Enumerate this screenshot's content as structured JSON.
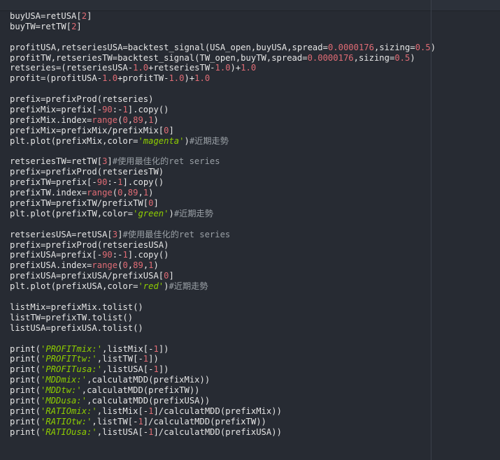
{
  "editor": {
    "lines": [
      [
        {
          "t": "buyUSA=retUSA[",
          "k": "txt"
        },
        {
          "t": "2",
          "k": "num"
        },
        {
          "t": "]",
          "k": "txt"
        }
      ],
      [
        {
          "t": "buyTW=retTW[",
          "k": "txt"
        },
        {
          "t": "2",
          "k": "num"
        },
        {
          "t": "]",
          "k": "txt"
        }
      ],
      [],
      [
        {
          "t": "profitUSA,retseriesUSA=backtest_signal(USA_open,buyUSA,spread=",
          "k": "txt"
        },
        {
          "t": "0.0000176",
          "k": "num"
        },
        {
          "t": ",sizing=",
          "k": "txt"
        },
        {
          "t": "0.5",
          "k": "num"
        },
        {
          "t": ")",
          "k": "txt"
        }
      ],
      [
        {
          "t": "profitTW,retseriesTW=backtest_signal(TW_open,buyTW,spread=",
          "k": "txt"
        },
        {
          "t": "0.0000176",
          "k": "num"
        },
        {
          "t": ",sizing=",
          "k": "txt"
        },
        {
          "t": "0.5",
          "k": "num"
        },
        {
          "t": ")",
          "k": "txt"
        }
      ],
      [
        {
          "t": "retseries=(retseriesUSA-",
          "k": "txt"
        },
        {
          "t": "1.0",
          "k": "num"
        },
        {
          "t": "+retseriesTW-",
          "k": "txt"
        },
        {
          "t": "1.0",
          "k": "num"
        },
        {
          "t": ")+",
          "k": "txt"
        },
        {
          "t": "1.0",
          "k": "num"
        }
      ],
      [
        {
          "t": "profit=(profitUSA-",
          "k": "txt"
        },
        {
          "t": "1.0",
          "k": "num"
        },
        {
          "t": "+profitTW-",
          "k": "txt"
        },
        {
          "t": "1.0",
          "k": "num"
        },
        {
          "t": ")+",
          "k": "txt"
        },
        {
          "t": "1.0",
          "k": "num"
        }
      ],
      [],
      [
        {
          "t": "prefix=prefixProd(retseries)",
          "k": "txt"
        }
      ],
      [
        {
          "t": "prefixMix=prefix[-",
          "k": "txt"
        },
        {
          "t": "90",
          "k": "num"
        },
        {
          "t": ":-",
          "k": "txt"
        },
        {
          "t": "1",
          "k": "num"
        },
        {
          "t": "].copy()",
          "k": "txt"
        }
      ],
      [
        {
          "t": "prefixMix.index=",
          "k": "txt"
        },
        {
          "t": "range",
          "k": "fn"
        },
        {
          "t": "(",
          "k": "txt"
        },
        {
          "t": "0",
          "k": "num"
        },
        {
          "t": ",",
          "k": "txt"
        },
        {
          "t": "89",
          "k": "num"
        },
        {
          "t": ",",
          "k": "txt"
        },
        {
          "t": "1",
          "k": "num"
        },
        {
          "t": ")",
          "k": "txt"
        }
      ],
      [
        {
          "t": "prefixMix=prefixMix/prefixMix[",
          "k": "txt"
        },
        {
          "t": "0",
          "k": "num"
        },
        {
          "t": "]",
          "k": "txt"
        }
      ],
      [
        {
          "t": "plt.plot(prefixMix,color=",
          "k": "txt"
        },
        {
          "t": "'magenta'",
          "k": "str"
        },
        {
          "t": ")",
          "k": "txt"
        },
        {
          "t": "#近期走勢",
          "k": "cmt"
        }
      ],
      [],
      [
        {
          "t": "retseriesTW=retTW[",
          "k": "txt"
        },
        {
          "t": "3",
          "k": "num"
        },
        {
          "t": "]",
          "k": "txt"
        },
        {
          "t": "#使用最佳化的ret series",
          "k": "cmt"
        }
      ],
      [
        {
          "t": "prefix=prefixProd(retseriesTW)",
          "k": "txt"
        }
      ],
      [
        {
          "t": "prefixTW=prefix[-",
          "k": "txt"
        },
        {
          "t": "90",
          "k": "num"
        },
        {
          "t": ":-",
          "k": "txt"
        },
        {
          "t": "1",
          "k": "num"
        },
        {
          "t": "].copy()",
          "k": "txt"
        }
      ],
      [
        {
          "t": "prefixTW.index=",
          "k": "txt"
        },
        {
          "t": "range",
          "k": "fn"
        },
        {
          "t": "(",
          "k": "txt"
        },
        {
          "t": "0",
          "k": "num"
        },
        {
          "t": ",",
          "k": "txt"
        },
        {
          "t": "89",
          "k": "num"
        },
        {
          "t": ",",
          "k": "txt"
        },
        {
          "t": "1",
          "k": "num"
        },
        {
          "t": ")",
          "k": "txt"
        }
      ],
      [
        {
          "t": "prefixTW=prefixTW/prefixTW[",
          "k": "txt"
        },
        {
          "t": "0",
          "k": "num"
        },
        {
          "t": "]",
          "k": "txt"
        }
      ],
      [
        {
          "t": "plt.plot(prefixTW,color=",
          "k": "txt"
        },
        {
          "t": "'green'",
          "k": "str"
        },
        {
          "t": ")",
          "k": "txt"
        },
        {
          "t": "#近期走勢",
          "k": "cmt"
        }
      ],
      [],
      [
        {
          "t": "retseriesUSA=retUSA[",
          "k": "txt"
        },
        {
          "t": "3",
          "k": "num"
        },
        {
          "t": "]",
          "k": "txt"
        },
        {
          "t": "#使用最佳化的ret series",
          "k": "cmt"
        }
      ],
      [
        {
          "t": "prefix=prefixProd(retseriesUSA)",
          "k": "txt"
        }
      ],
      [
        {
          "t": "prefixUSA=prefix[-",
          "k": "txt"
        },
        {
          "t": "90",
          "k": "num"
        },
        {
          "t": ":-",
          "k": "txt"
        },
        {
          "t": "1",
          "k": "num"
        },
        {
          "t": "].copy()",
          "k": "txt"
        }
      ],
      [
        {
          "t": "prefixUSA.index=",
          "k": "txt"
        },
        {
          "t": "range",
          "k": "fn"
        },
        {
          "t": "(",
          "k": "txt"
        },
        {
          "t": "0",
          "k": "num"
        },
        {
          "t": ",",
          "k": "txt"
        },
        {
          "t": "89",
          "k": "num"
        },
        {
          "t": ",",
          "k": "txt"
        },
        {
          "t": "1",
          "k": "num"
        },
        {
          "t": ")",
          "k": "txt"
        }
      ],
      [
        {
          "t": "prefixUSA=prefixUSA/prefixUSA[",
          "k": "txt"
        },
        {
          "t": "0",
          "k": "num"
        },
        {
          "t": "]",
          "k": "txt"
        }
      ],
      [
        {
          "t": "plt.plot(prefixUSA,color=",
          "k": "txt"
        },
        {
          "t": "'red'",
          "k": "str"
        },
        {
          "t": ")",
          "k": "txt"
        },
        {
          "t": "#近期走勢",
          "k": "cmt"
        }
      ],
      [],
      [
        {
          "t": "listMix=prefixMix.tolist()",
          "k": "txt"
        }
      ],
      [
        {
          "t": "listTW=prefixTW.tolist()",
          "k": "txt"
        }
      ],
      [
        {
          "t": "listUSA=prefixUSA.tolist()",
          "k": "txt"
        }
      ],
      [],
      [
        {
          "t": "print(",
          "k": "txt"
        },
        {
          "t": "'PROFITmix:'",
          "k": "str"
        },
        {
          "t": ",listMix[-",
          "k": "txt"
        },
        {
          "t": "1",
          "k": "num"
        },
        {
          "t": "])",
          "k": "txt"
        }
      ],
      [
        {
          "t": "print(",
          "k": "txt"
        },
        {
          "t": "'PROFITtw:'",
          "k": "str"
        },
        {
          "t": ",listTW[-",
          "k": "txt"
        },
        {
          "t": "1",
          "k": "num"
        },
        {
          "t": "])",
          "k": "txt"
        }
      ],
      [
        {
          "t": "print(",
          "k": "txt"
        },
        {
          "t": "'PROFITusa:'",
          "k": "str"
        },
        {
          "t": ",listUSA[-",
          "k": "txt"
        },
        {
          "t": "1",
          "k": "num"
        },
        {
          "t": "])",
          "k": "txt"
        }
      ],
      [
        {
          "t": "print(",
          "k": "txt"
        },
        {
          "t": "'MDDmix:'",
          "k": "str"
        },
        {
          "t": ",calculatMDD(prefixMix))",
          "k": "txt"
        }
      ],
      [
        {
          "t": "print(",
          "k": "txt"
        },
        {
          "t": "'MDDtw:'",
          "k": "str"
        },
        {
          "t": ",calculatMDD(prefixTW))",
          "k": "txt"
        }
      ],
      [
        {
          "t": "print(",
          "k": "txt"
        },
        {
          "t": "'MDDusa:'",
          "k": "str"
        },
        {
          "t": ",calculatMDD(prefixUSA))",
          "k": "txt"
        }
      ],
      [
        {
          "t": "print(",
          "k": "txt"
        },
        {
          "t": "'RATIOmix:'",
          "k": "str"
        },
        {
          "t": ",listMix[-",
          "k": "txt"
        },
        {
          "t": "1",
          "k": "num"
        },
        {
          "t": "]/calculatMDD(prefixMix))",
          "k": "txt"
        }
      ],
      [
        {
          "t": "print(",
          "k": "txt"
        },
        {
          "t": "'RATIOtw:'",
          "k": "str"
        },
        {
          "t": ",listTW[-",
          "k": "txt"
        },
        {
          "t": "1",
          "k": "num"
        },
        {
          "t": "]/calculatMDD(prefixTW))",
          "k": "txt"
        }
      ],
      [
        {
          "t": "print(",
          "k": "txt"
        },
        {
          "t": "'RATIOusa:'",
          "k": "str"
        },
        {
          "t": ",listUSA[-",
          "k": "txt"
        },
        {
          "t": "1",
          "k": "num"
        },
        {
          "t": "]/calculatMDD(prefixUSA))",
          "k": "txt"
        }
      ]
    ]
  },
  "colors": {
    "background": "#272b33",
    "text": "#e6e6e6",
    "number": "#e06c75",
    "string": "#8fce00",
    "comment": "#9aa0a6"
  }
}
